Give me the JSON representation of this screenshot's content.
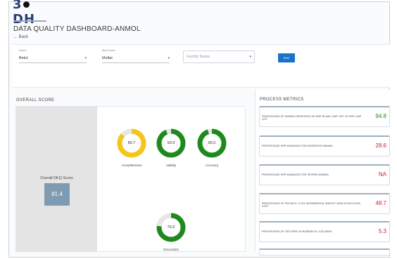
{
  "logo": {
    "text_left": "3",
    "text_right": "DH"
  },
  "page": {
    "title": "DATA QUALITY DASHBOARD-ANMOL",
    "back_label": "Back",
    "back_icon": "arrow-left-icon"
  },
  "filters": {
    "district": {
      "label": "District",
      "value": "Betul"
    },
    "block": {
      "label": "Block Name",
      "value": "Multai"
    },
    "facility": {
      "placeholder": "Facility Name"
    },
    "run_label": "RUN",
    "accent": "#1a73c8"
  },
  "overall": {
    "heading": "OVERALL SCORE",
    "score_label": "Overall DKQ Score",
    "score_value": "81.4",
    "gauges": [
      {
        "value": "86.7",
        "label": "Completeness",
        "fraction": 0.867,
        "color": "#f5c518"
      },
      {
        "value": "93.9",
        "label": "Validity",
        "fraction": 0.939,
        "color": "#1e8a1e"
      },
      {
        "value": "95.0",
        "label": "Accuracy",
        "fraction": 0.95,
        "color": "#1e8a1e"
      },
      {
        "value": "76.6",
        "label": "Discordant",
        "fraction": 0.766,
        "color": "#1e8a1e"
      }
    ]
  },
  "process_metrics": {
    "heading": "PROCESS METRICS",
    "items": [
      {
        "text": "PERCENTAGE OF WOMEN IDENTIFIED AS HRP IN ANC LINE LIST VS HRP LINE LIST",
        "value": "94.8",
        "color": "#1e8a1e"
      },
      {
        "text": "PERCENTAGE HRP MANAGED FOR MODERATE ANEMIA",
        "value": "28.6",
        "color": "#d0202a"
      },
      {
        "text": "PERCENTAGE HRP MANAGED FOR SEVERE ANEMIA",
        "value": "NA",
        "color": "#d0202a"
      },
      {
        "text": "PERCENTAGE OF PW WITH <2 KG INCREMENTAL WEIGHT GAIN IN EACH ANC VISIT",
        "value": "48.7",
        "color": "#d0202a"
      },
      {
        "text": "PERCENTAGE OF OUTLIERS IN NUMERICAL COLUMNS",
        "value": "5.3",
        "color": "#d0202a"
      }
    ]
  }
}
